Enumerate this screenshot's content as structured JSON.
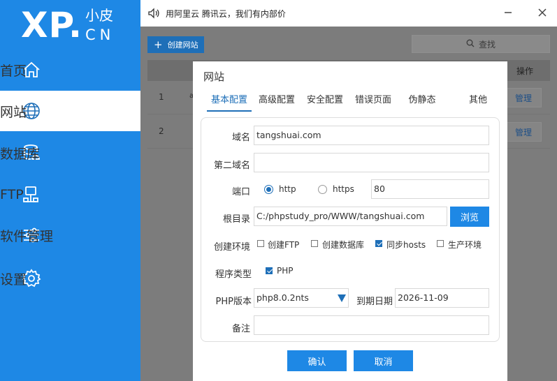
{
  "brand": {
    "logo_main": "XP.",
    "logo_cn_top": "小皮",
    "logo_cn_bottom": "CN"
  },
  "sidebar": {
    "items": [
      {
        "label": "首页",
        "icon": "home-icon"
      },
      {
        "label": "网站",
        "icon": "globe-icon",
        "active": true
      },
      {
        "label": "数据库",
        "icon": "database-icon"
      },
      {
        "label": "FTP",
        "icon": "ftp-icon"
      },
      {
        "label": "软件管理",
        "icon": "sliders-icon"
      },
      {
        "label": "设置",
        "icon": "gear-icon"
      }
    ]
  },
  "titlebar": {
    "notice": "用阿里云 腾讯云，我们有内部价"
  },
  "toolbar": {
    "create_label": "创建网站",
    "search_label": "查找"
  },
  "table": {
    "op_header": "操作",
    "rows": [
      {
        "num": "1",
        "snippet": "a",
        "manage": "管理"
      },
      {
        "num": "2",
        "snippet": "",
        "manage": "管理"
      }
    ]
  },
  "modal": {
    "title": "网站",
    "tabs": [
      "基本配置",
      "高级配置",
      "安全配置",
      "错误页面",
      "伪静态",
      "其他"
    ],
    "active_tab": "基本配置",
    "form": {
      "domain_label": "域名",
      "domain_value": "tangshuai.com",
      "second_domain_label": "第二域名",
      "second_domain_value": "",
      "port_label": "端口",
      "http_label": "http",
      "https_label": "https",
      "port_value": "80",
      "root_label": "根目录",
      "root_value": "C:/phpstudy_pro/WWW/tangshuai.com",
      "browse_label": "浏览",
      "env_label": "创建环境",
      "env_options": [
        {
          "label": "创建FTP",
          "checked": false
        },
        {
          "label": "创建数据库",
          "checked": false
        },
        {
          "label": "同步hosts",
          "checked": true
        },
        {
          "label": "生产环境",
          "checked": false
        }
      ],
      "program_type_label": "程序类型",
      "program_type_option": "PHP",
      "php_version_label": "PHP版本",
      "php_version_value": "php8.0.2nts",
      "expire_label": "到期日期",
      "expire_value": "2026-11-09",
      "note_label": "备注",
      "note_value": ""
    },
    "confirm_label": "确认",
    "cancel_label": "取消"
  },
  "colors": {
    "accent": "#1e88e5",
    "dark_accent": "#1e6fb8",
    "overlay": "#7c7c7c"
  }
}
